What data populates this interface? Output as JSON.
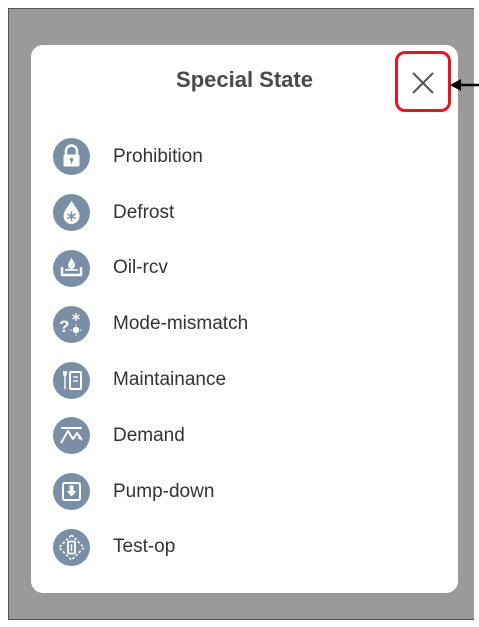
{
  "dialog": {
    "title": "Special State",
    "close_icon": "close-icon"
  },
  "colors": {
    "overlay": "#9a9a9a",
    "icon_bg": "#7a8fa6",
    "highlight": "#e4151f",
    "text": "#333333"
  },
  "items": [
    {
      "label": "Prohibition",
      "icon": "lock-icon"
    },
    {
      "label": "Defrost",
      "icon": "defrost-icon"
    },
    {
      "label": "Oil-rcv",
      "icon": "oil-recovery-icon"
    },
    {
      "label": "Mode-mismatch",
      "icon": "mode-mismatch-icon"
    },
    {
      "label": "Maintainance",
      "icon": "maintenance-icon"
    },
    {
      "label": "Demand",
      "icon": "demand-icon"
    },
    {
      "label": "Pump-down",
      "icon": "pump-down-icon"
    },
    {
      "label": "Test-op",
      "icon": "test-op-icon"
    }
  ]
}
